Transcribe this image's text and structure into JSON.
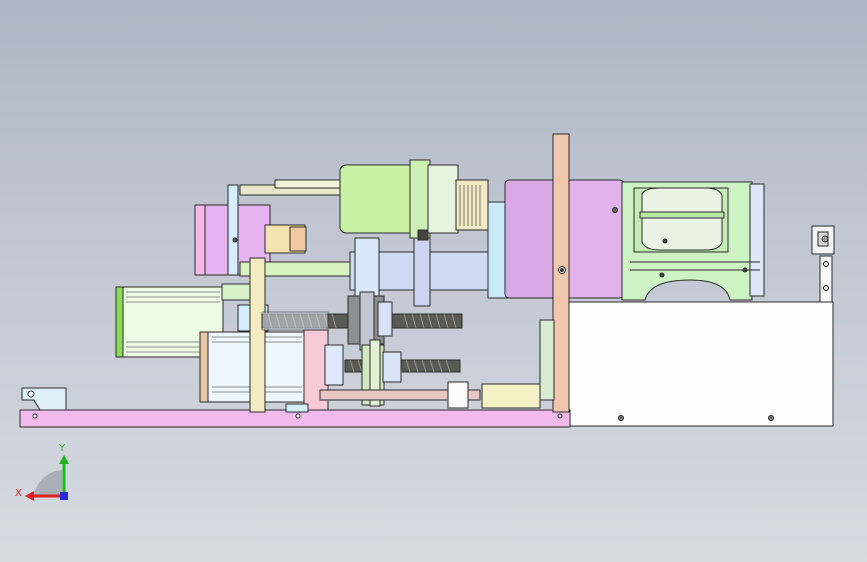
{
  "viewport": {
    "background_top": "#aeb6c5",
    "background_bottom": "#d6dae1",
    "model_colors": {
      "base_plate": "#f2b9ec",
      "housing": "#fdfdfd",
      "upright": "#f1c8ae",
      "spindle_motor": "#d9a9e6",
      "gear_housing": "#c9f2a4",
      "shaft": "#cfd9f1",
      "collet_body": "#cdf3c5",
      "leadscrew": "#5a5a55",
      "stepper_motor": "#edfbe4"
    }
  },
  "triad": {
    "x_label": "X",
    "y_label": "Y",
    "x_color": "#e02020",
    "y_color": "#1fb51f",
    "z_color": "#2a2ad8"
  }
}
